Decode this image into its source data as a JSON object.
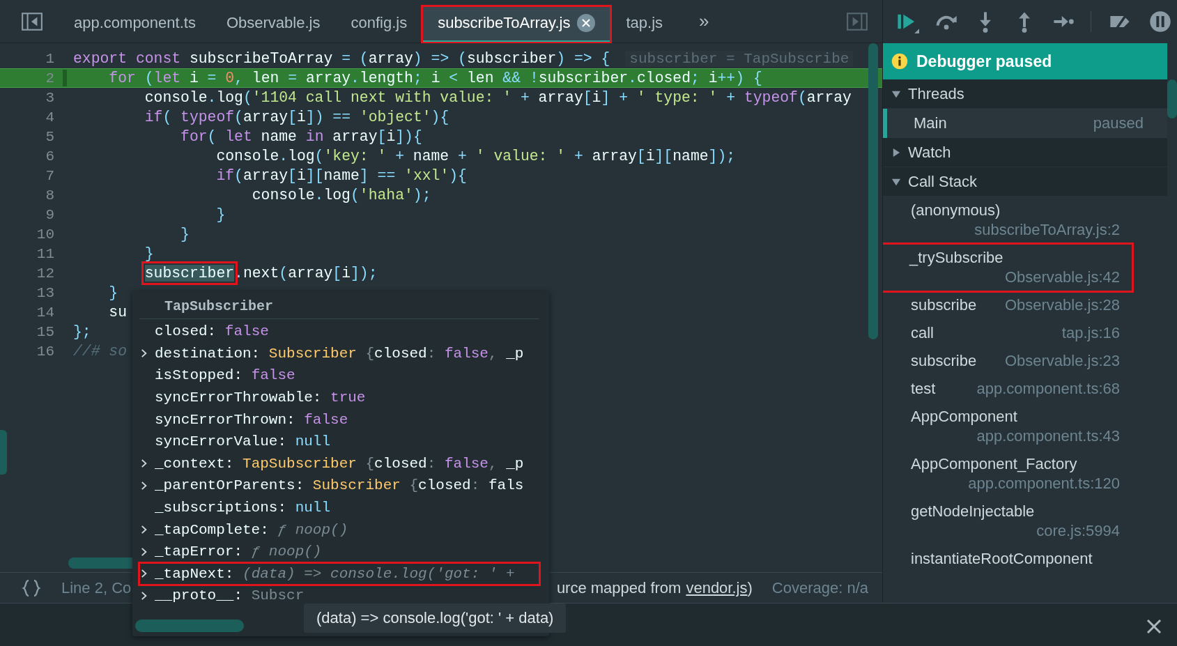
{
  "tabs": [
    {
      "label": "app.component.ts",
      "selected": false,
      "annotated": false
    },
    {
      "label": "Observable.js",
      "selected": false,
      "annotated": false
    },
    {
      "label": "config.js",
      "selected": false,
      "annotated": false
    },
    {
      "label": "subscribeToArray.js",
      "selected": true,
      "annotated": true
    },
    {
      "label": "tap.js",
      "selected": false,
      "annotated": false
    }
  ],
  "more_tabs": "»",
  "code_lines": [
    {
      "number": "1",
      "current": false,
      "text": "export const subscribeToArray = (array) => (subscriber) => {",
      "hint": "subscriber = TapSubscribe"
    },
    {
      "number": "2",
      "current": true,
      "text": "    for (let i = 0, len = array.length; i < len && !subscriber.closed; i++) {"
    },
    {
      "number": "3",
      "current": false,
      "text": "        console.log('1104 call next with value: ' + array[i] + ' type: ' + typeof(array"
    },
    {
      "number": "4",
      "current": false,
      "text": "        if( typeof(array[i]) == 'object'){"
    },
    {
      "number": "5",
      "current": false,
      "text": "            for( let name in array[i]){"
    },
    {
      "number": "6",
      "current": false,
      "text": "                console.log('key: ' + name + ' value: ' + array[i][name]);"
    },
    {
      "number": "7",
      "current": false,
      "text": "                if(array[i][name] == 'xxl'){"
    },
    {
      "number": "8",
      "current": false,
      "text": "                    console.log('haha');"
    },
    {
      "number": "9",
      "current": false,
      "text": "                }"
    },
    {
      "number": "10",
      "current": false,
      "text": "            }"
    },
    {
      "number": "11",
      "current": false,
      "text": "        }"
    },
    {
      "number": "12",
      "current": false,
      "annotated_prefix": "        subscriber",
      "text": ".next(array[i]);"
    },
    {
      "number": "13",
      "current": false,
      "text": "    }"
    },
    {
      "number": "14",
      "current": false,
      "text": "    su"
    },
    {
      "number": "15",
      "current": false,
      "text": "};"
    },
    {
      "number": "16",
      "current": false,
      "text": "//# so",
      "kind": "comment"
    }
  ],
  "status_bar": {
    "position": "Line 2, Co",
    "source_prefix": "urce mapped from",
    "source_link": "vendor.js",
    "source_suffix": ")",
    "coverage": "Coverage: n/a"
  },
  "popover": {
    "title": "TapSubscriber",
    "rows": [
      {
        "key": "closed:",
        "expandable": false,
        "annotated": false,
        "value": "false"
      },
      {
        "key": "destination:",
        "expandable": true,
        "annotated": false,
        "value": "Subscriber {closed: false, _p"
      },
      {
        "key": "isStopped:",
        "expandable": false,
        "annotated": false,
        "value": "false"
      },
      {
        "key": "syncErrorThrowable:",
        "expandable": false,
        "annotated": false,
        "value": "true"
      },
      {
        "key": "syncErrorThrown:",
        "expandable": false,
        "annotated": false,
        "value": "false"
      },
      {
        "key": "syncErrorValue:",
        "expandable": false,
        "annotated": false,
        "value": "null"
      },
      {
        "key": "_context:",
        "expandable": true,
        "annotated": false,
        "value": "TapSubscriber {closed: false, _p"
      },
      {
        "key": "_parentOrParents:",
        "expandable": true,
        "annotated": false,
        "value": "Subscriber {closed: fals"
      },
      {
        "key": "_subscriptions:",
        "expandable": false,
        "annotated": false,
        "value": "null"
      },
      {
        "key": "_tapComplete:",
        "expandable": true,
        "annotated": false,
        "value": "ƒ noop()",
        "kind": "function"
      },
      {
        "key": "_tapError:",
        "expandable": true,
        "annotated": false,
        "value": "ƒ noop()",
        "kind": "function"
      },
      {
        "key": "_tapNext:",
        "expandable": true,
        "annotated": true,
        "value": "(data) => console.log('got: ' +",
        "kind": "function"
      },
      {
        "key": "__proto__:",
        "expandable": true,
        "annotated": false,
        "value": "Subscr",
        "kind": "prototype"
      }
    ]
  },
  "tooltip": "(data) => console.log('got: ' + data)",
  "debugger": {
    "banner": "Debugger paused",
    "sections": [
      {
        "title": "Threads",
        "expanded": true,
        "kind": "threads",
        "items": [
          {
            "name": "Main",
            "state": "paused",
            "selected": true
          }
        ]
      },
      {
        "title": "Watch",
        "expanded": false
      },
      {
        "title": "Call Stack",
        "expanded": true,
        "kind": "frames",
        "items": [
          {
            "name": "(anonymous)",
            "location": "subscribeToArray.js:2",
            "annotated": false
          },
          {
            "name": "_trySubscribe",
            "location": "Observable.js:42",
            "annotated": true
          },
          {
            "name": "subscribe",
            "location": "Observable.js:28",
            "annotated": false
          },
          {
            "name": "call",
            "location": "tap.js:16",
            "annotated": false
          },
          {
            "name": "subscribe",
            "location": "Observable.js:23",
            "annotated": false
          },
          {
            "name": "test",
            "location": "app.component.ts:68",
            "annotated": false
          },
          {
            "name": "AppComponent",
            "location": "app.component.ts:43",
            "annotated": false
          },
          {
            "name": "AppComponent_Factory",
            "location": "app.component.ts:120",
            "annotated": false
          },
          {
            "name": "getNodeInjectable",
            "location": "core.js:5994",
            "annotated": false
          },
          {
            "name": "instantiateRootComponent",
            "annotated": false
          }
        ]
      }
    ]
  }
}
